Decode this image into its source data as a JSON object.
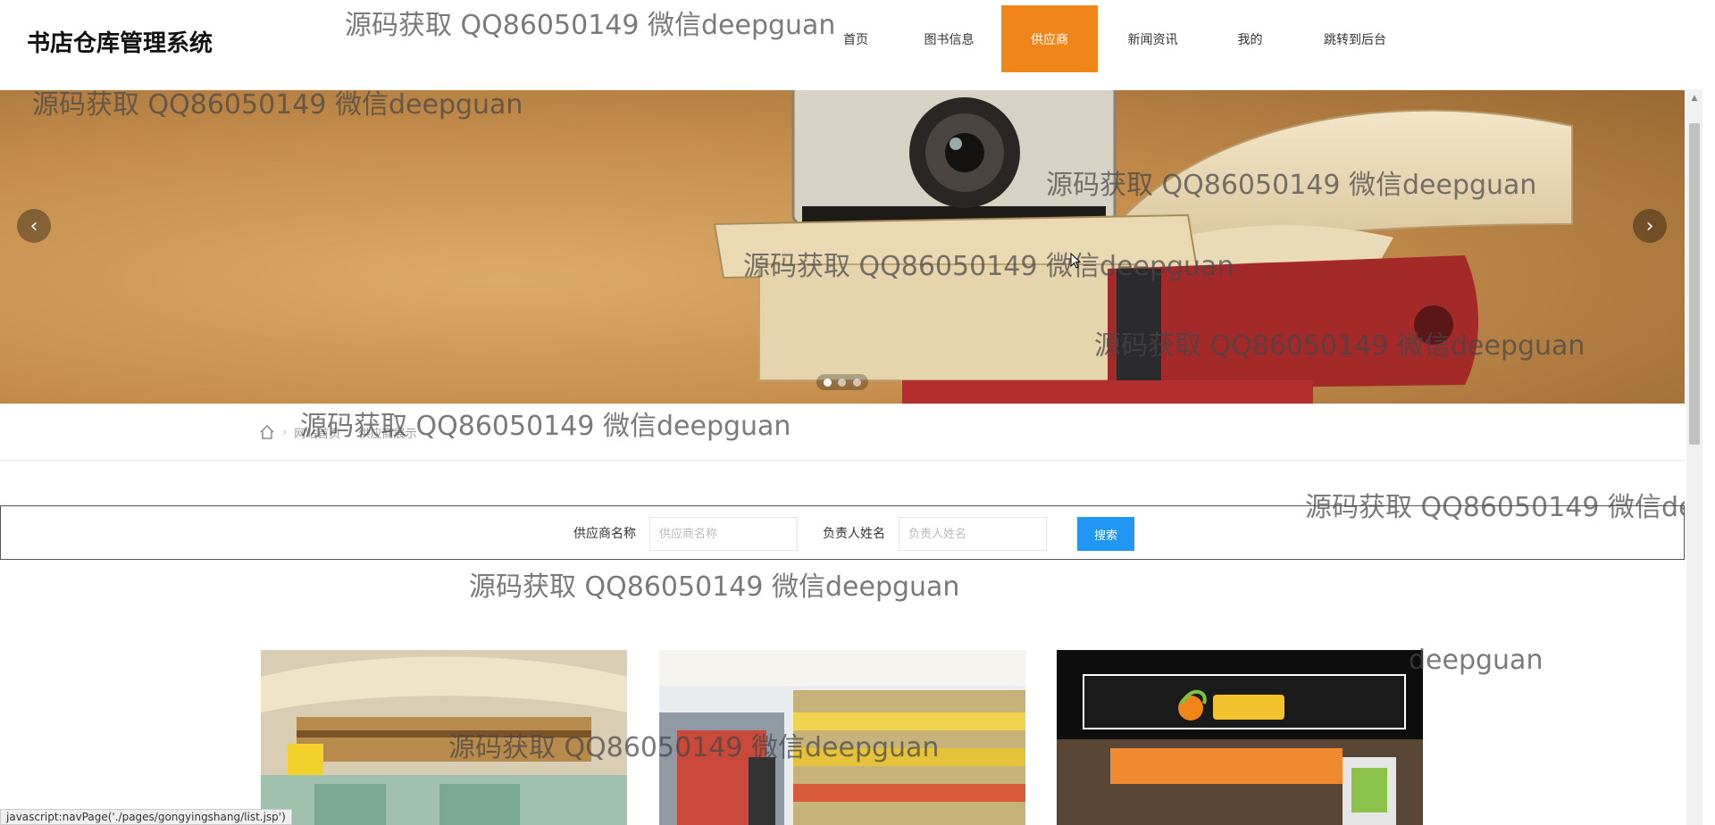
{
  "header": {
    "site_title": "书店仓库管理系统"
  },
  "nav": {
    "items": [
      {
        "label": "首页",
        "active": false
      },
      {
        "label": "图书信息",
        "active": false
      },
      {
        "label": "供应商",
        "active": true
      },
      {
        "label": "新闻资讯",
        "active": false
      },
      {
        "label": "我的",
        "active": false
      },
      {
        "label": "跳转到后台",
        "active": false
      }
    ]
  },
  "banner": {
    "prev_icon": "chevron-left-icon",
    "next_icon": "chevron-right-icon",
    "slide_count": 3,
    "active_slide": 1
  },
  "breadcrumb": {
    "home_icon": "home-icon",
    "items": [
      "网站首页",
      "供应商展示"
    ]
  },
  "search": {
    "supplier_label": "供应商名称",
    "supplier_placeholder": "供应商名称",
    "contact_label": "负责人姓名",
    "contact_placeholder": "负责人姓名",
    "button_label": "搜索"
  },
  "watermark": {
    "text": "源码获取 QQ86050149 微信deepguan",
    "partial_right": "源码获取 QQ86050149 微信deep",
    "partial_card": "deepguan"
  },
  "statusbar": {
    "text": "javascript:navPage('./pages/gongyingshang/list.jsp')"
  },
  "colors": {
    "accent_orange": "#f08519",
    "button_blue": "#2196f3"
  }
}
